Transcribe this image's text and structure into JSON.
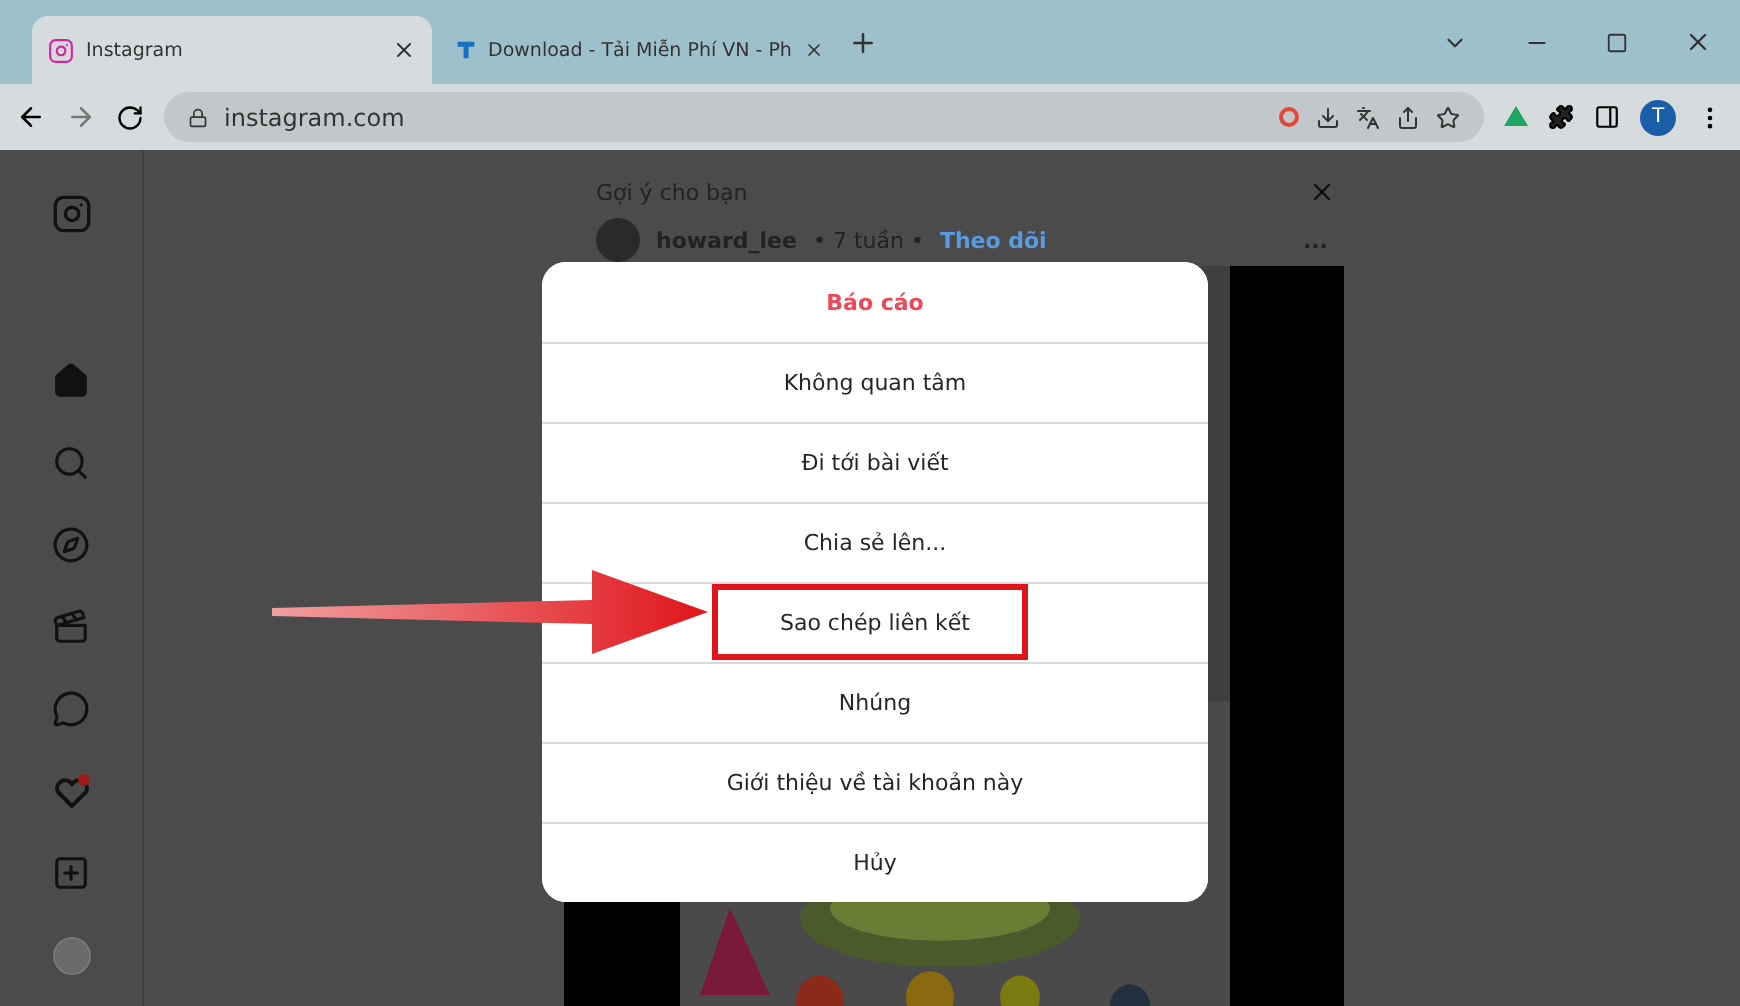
{
  "browser": {
    "tabs": [
      {
        "title": "Instagram",
        "selected": true,
        "kind": "instagram"
      },
      {
        "title": "Download - Tải Miễn Phí VN - Ph",
        "selected": false,
        "kind": "t"
      }
    ],
    "url": "instagram.com",
    "profile": "T"
  },
  "feed": {
    "title": "Gợi ý cho bạn",
    "author": "howard_lee",
    "time": "• 7 tuần •",
    "follow": "Theo dõi",
    "more": "..."
  },
  "menu": {
    "items": [
      {
        "label": "Báo cáo",
        "kind": "danger",
        "highlighted": false
      },
      {
        "label": "Không quan tâm",
        "kind": "normal",
        "highlighted": false
      },
      {
        "label": "Đi tới bài viết",
        "kind": "normal",
        "highlighted": false
      },
      {
        "label": "Chia sẻ lên...",
        "kind": "normal",
        "highlighted": false
      },
      {
        "label": "Sao chép liên kết",
        "kind": "normal",
        "highlighted": true
      },
      {
        "label": "Nhúng",
        "kind": "normal",
        "highlighted": false
      },
      {
        "label": "Giới thiệu về tài khoản này",
        "kind": "normal",
        "highlighted": false
      },
      {
        "label": "Hủy",
        "kind": "normal",
        "highlighted": false
      }
    ]
  }
}
